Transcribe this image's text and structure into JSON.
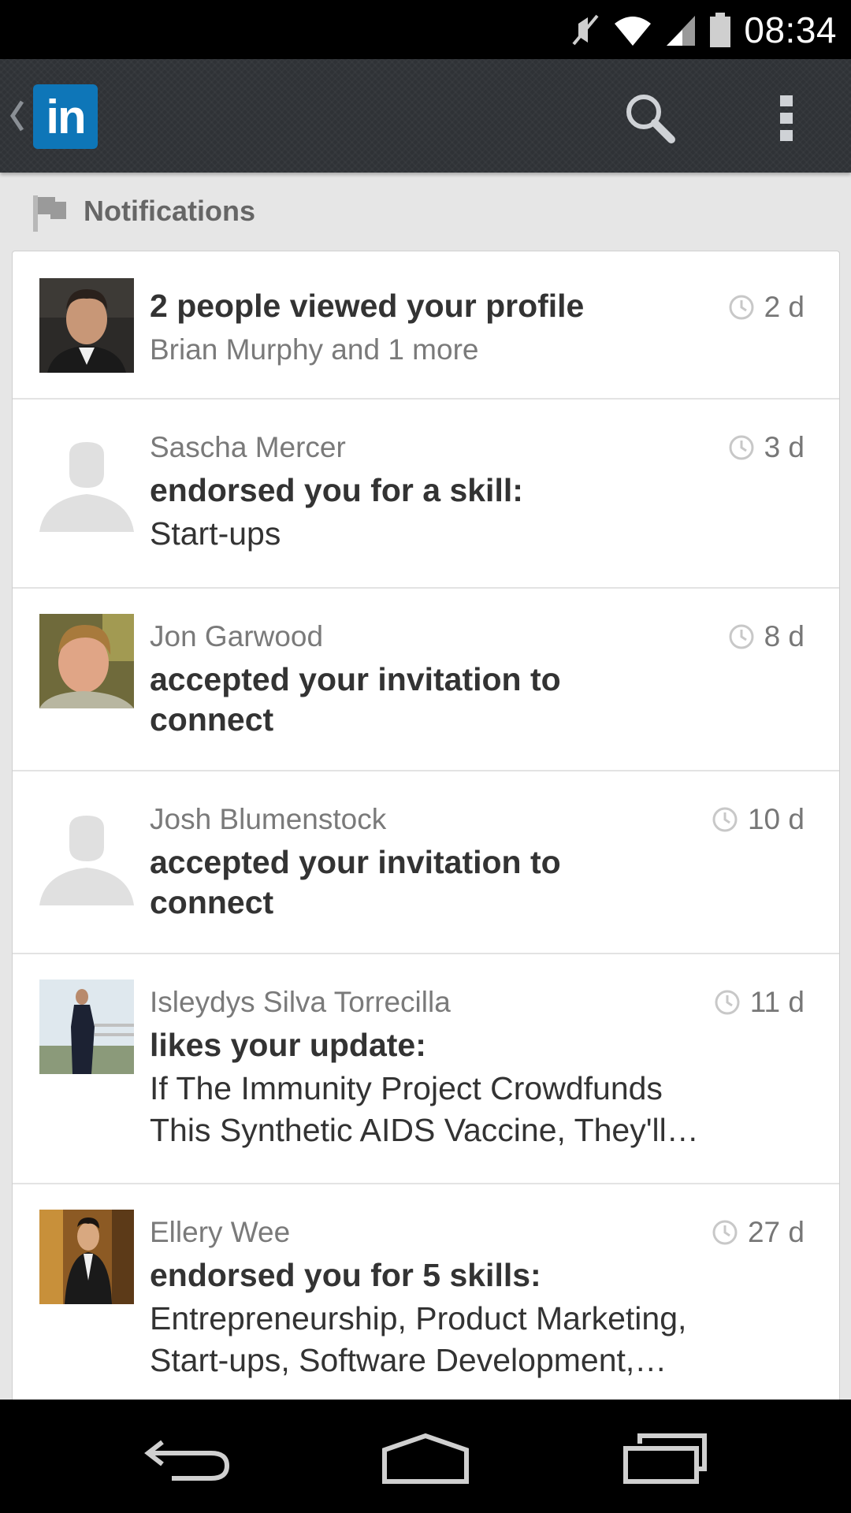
{
  "status_bar": {
    "time": "08:34",
    "icons": [
      "mute-icon",
      "wifi-icon",
      "signal-icon",
      "battery-icon"
    ]
  },
  "action_bar": {
    "logo_text": "in",
    "icons": [
      "up-caret-icon",
      "search-icon",
      "overflow-menu-icon"
    ]
  },
  "section": {
    "title": "Notifications",
    "icon": "flag-icon"
  },
  "notifications": [
    {
      "title": "2 people viewed your profile",
      "subtitle": "Brian Murphy and 1 more",
      "time": "2 d",
      "avatar": "photo"
    },
    {
      "name": "Sascha Mercer",
      "action": "endorsed you for a skill:",
      "detail_lines": [
        "Start-ups"
      ],
      "time": "3 d",
      "avatar": "placeholder"
    },
    {
      "name": "Jon Garwood",
      "action_lines": [
        "accepted your invitation to",
        "connect"
      ],
      "time": "8 d",
      "avatar": "photo"
    },
    {
      "name": "Josh Blumenstock",
      "action_lines": [
        "accepted your invitation to",
        "connect"
      ],
      "time": "10 d",
      "avatar": "placeholder"
    },
    {
      "name": "Isleydys Silva Torrecilla",
      "action": "likes your update:",
      "detail_lines": [
        "If The Immunity Project Crowdfunds",
        "This Synthetic AIDS Vaccine, They'll…"
      ],
      "time": "11 d",
      "avatar": "photo"
    },
    {
      "name": "Ellery Wee",
      "action": "endorsed you for 5 skills:",
      "detail_lines": [
        "Entrepreneurship, Product Marketing,",
        "Start-ups, Software Development,…"
      ],
      "time": "27 d",
      "avatar": "photo"
    }
  ],
  "nav_bar": {
    "icons": [
      "back-icon",
      "home-icon",
      "recent-apps-icon"
    ]
  },
  "colors": {
    "linkedin_blue": "#0e76b8",
    "action_bar": "#2f3236",
    "background": "#e6e6e6"
  }
}
